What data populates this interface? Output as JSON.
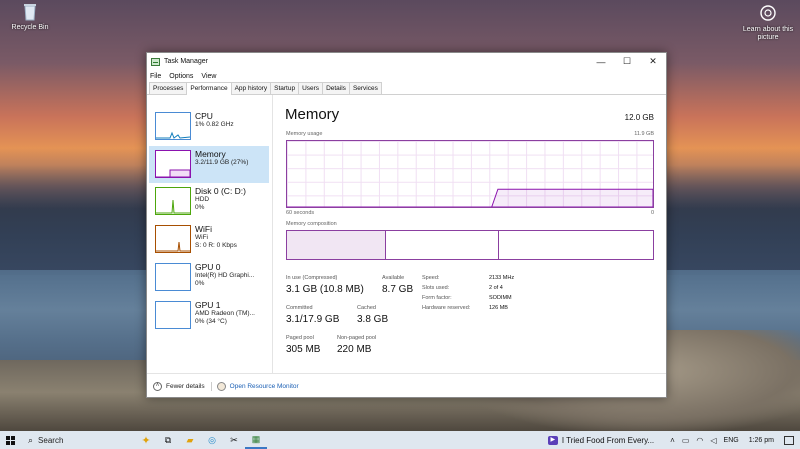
{
  "desktop": {
    "icons": [
      {
        "label": "Recycle Bin"
      },
      {
        "label": "Learn about this picture"
      }
    ]
  },
  "window": {
    "title": "Task Manager",
    "controls": {
      "minimize": "—",
      "maximize": "☐",
      "close": "✕"
    }
  },
  "menu": [
    "File",
    "Options",
    "View"
  ],
  "tabs": [
    {
      "label": "Processes",
      "active": false
    },
    {
      "label": "Performance",
      "active": true
    },
    {
      "label": "App history",
      "active": false
    },
    {
      "label": "Startup",
      "active": false
    },
    {
      "label": "Users",
      "active": false
    },
    {
      "label": "Details",
      "active": false
    },
    {
      "label": "Services",
      "active": false
    }
  ],
  "resources": [
    {
      "name": "CPU",
      "line1": "1% 0.82 GHz",
      "line2": "",
      "color": "#117dbb",
      "selected": false
    },
    {
      "name": "Memory",
      "line1": "3.2/11.9 GB (27%)",
      "line2": "",
      "color": "#8b12ae",
      "selected": true
    },
    {
      "name": "Disk 0 (C: D:)",
      "line1": "HDD",
      "line2": "0%",
      "color": "#4da60c",
      "selected": false
    },
    {
      "name": "WiFi",
      "line1": "WiFi",
      "line2": "S: 0 R: 0 Kbps",
      "color": "#a74f01",
      "selected": false
    },
    {
      "name": "GPU 0",
      "line1": "Intel(R) HD Graphi...",
      "line2": "0%",
      "color": "#117dbb",
      "selected": false
    },
    {
      "name": "GPU 1",
      "line1": "AMD Radeon (TM)...",
      "line2": "0% (34 °C)",
      "color": "#117dbb",
      "selected": false
    }
  ],
  "detail": {
    "title": "Memory",
    "total": "12.0 GB",
    "usage_label": "Memory usage",
    "usage_max": "11.9 GB",
    "time_left": "60 seconds",
    "time_right": "0",
    "composition_label": "Memory composition",
    "usage_history_fraction": [
      0,
      0,
      0,
      0,
      0,
      0,
      0,
      0,
      0,
      0,
      0,
      0,
      0,
      0,
      0,
      0,
      0,
      0,
      0,
      0,
      0,
      0,
      0,
      0,
      0,
      0,
      0,
      0,
      0,
      0,
      0,
      0,
      0,
      0,
      0.27,
      0.27,
      0.27,
      0.27,
      0.27,
      0.27,
      0.27,
      0.27,
      0.27,
      0.27,
      0.27,
      0.27,
      0.27,
      0.27,
      0.27,
      0.27,
      0.27,
      0.27,
      0.27,
      0.27,
      0.27,
      0.27,
      0.27,
      0.27,
      0.27,
      0.27
    ],
    "composition_fractions": [
      0.27,
      0.31,
      0.42
    ],
    "stats": [
      {
        "label": "In use (Compressed)",
        "value": "3.1 GB (10.8 MB)"
      },
      {
        "label": "Available",
        "value": "8.7 GB"
      },
      {
        "label": "Committed",
        "value": "3.1/17.9 GB"
      },
      {
        "label": "Cached",
        "value": "3.8 GB"
      },
      {
        "label": "Paged pool",
        "value": "305 MB"
      },
      {
        "label": "Non-paged pool",
        "value": "220 MB"
      }
    ],
    "specs": [
      {
        "label": "Speed:",
        "value": "2133 MHz"
      },
      {
        "label": "Slots used:",
        "value": "2 of 4"
      },
      {
        "label": "Form factor:",
        "value": "SODIMM"
      },
      {
        "label": "Hardware reserved:",
        "value": "126 MB"
      }
    ]
  },
  "footer": {
    "fewer_details": "Fewer details",
    "open_monitor": "Open Resource Monitor"
  },
  "taskbar": {
    "search_label": "Search",
    "media_title": "I Tried Food From Every...",
    "language": "ENG",
    "time": "1:26 pm"
  }
}
